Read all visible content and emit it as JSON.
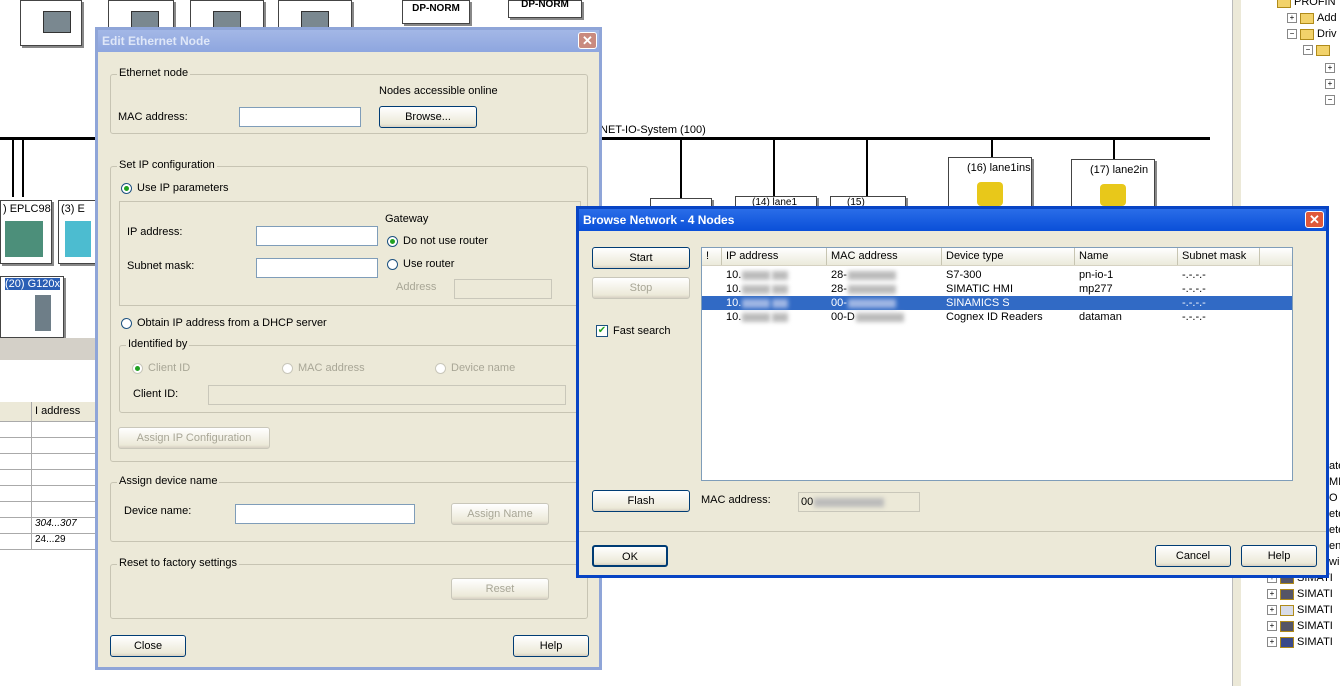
{
  "background": {
    "device_labels": {
      "dp_norm_1": "DP-NORM",
      "dp_norm_2": "DP-NORM",
      "epc": ") EPLC98",
      "dev3": "(3) E",
      "g120": "(20) G120x",
      "lane1": "(16) lane1ins",
      "lane2": "(17) lane2in",
      "dev14": "(14) lane1",
      "dev15": "(15)",
      "net_system": "NET-IO-System (100)"
    },
    "grid": {
      "header": "I address",
      "cells": [
        "304...307",
        "24...29"
      ]
    },
    "tree": {
      "items": [
        "PROFIN",
        "Add",
        "Driv",
        "",
        "",
        "",
        "",
        "ate",
        "MI",
        "O",
        "ete",
        "ete",
        "en",
        "wi",
        "SIMATI",
        "SIMATI",
        "SIMATI",
        "SIMATI",
        "SIMATI"
      ]
    }
  },
  "edit_node": {
    "title": "Edit Ethernet Node",
    "ethernet_node_group": "Ethernet node",
    "nodes_accessible": "Nodes accessible online",
    "mac_label": "MAC address:",
    "mac_value": "",
    "browse_button": "Browse...",
    "ip_config_group": "Set IP configuration",
    "use_ip_params": "Use IP parameters",
    "ip_address_label": "IP address:",
    "subnet_mask_label": "Subnet mask:",
    "gateway_label": "Gateway",
    "do_not_use_router": "Do not use router",
    "use_router": "Use router",
    "address_label": "Address",
    "obtain_dhcp": "Obtain IP address from a DHCP server",
    "identified_by": "Identified by",
    "client_id_radio": "Client ID",
    "mac_address_radio": "MAC address",
    "device_name_radio": "Device name",
    "client_id_label": "Client ID:",
    "assign_ip_button": "Assign IP Configuration",
    "assign_name_group": "Assign device name",
    "device_name_label": "Device name:",
    "assign_name_button": "Assign Name",
    "reset_group": "Reset to factory settings",
    "reset_button": "Reset",
    "close_button": "Close",
    "help_button": "Help"
  },
  "browse": {
    "title": "Browse Network - 4 Nodes",
    "start_button": "Start",
    "stop_button": "Stop",
    "fast_search": "Fast search",
    "flash_button": "Flash",
    "mac_label": "MAC address:",
    "mac_value": "00",
    "ok_button": "OK",
    "cancel_button": "Cancel",
    "help_button": "Help",
    "columns": [
      "!",
      "IP address",
      "MAC address",
      "Device type",
      "Name",
      "Subnet mask"
    ],
    "rows": [
      {
        "ip": "10.",
        "mac": "28-",
        "type": "S7-300",
        "name": "pn-io-1",
        "mask": "-.-.-.-",
        "selected": false
      },
      {
        "ip": "10.",
        "mac": "28-",
        "type": "SIMATIC HMI",
        "name": "mp277",
        "mask": "-.-.-.-",
        "selected": false
      },
      {
        "ip": "10.",
        "mac": "00-",
        "type": "SINAMICS S",
        "name": "",
        "mask": "-.-.-.-",
        "selected": true
      },
      {
        "ip": "10.",
        "mac": "00-D",
        "type": "Cognex ID Readers",
        "name": "dataman",
        "mask": "-.-.-.-",
        "selected": false
      }
    ]
  },
  "colors": {
    "title_active": "#0a4fd8",
    "title_inactive": "#8ea6df",
    "dialog_bg": "#ece9d8",
    "selection": "#316ac5"
  }
}
